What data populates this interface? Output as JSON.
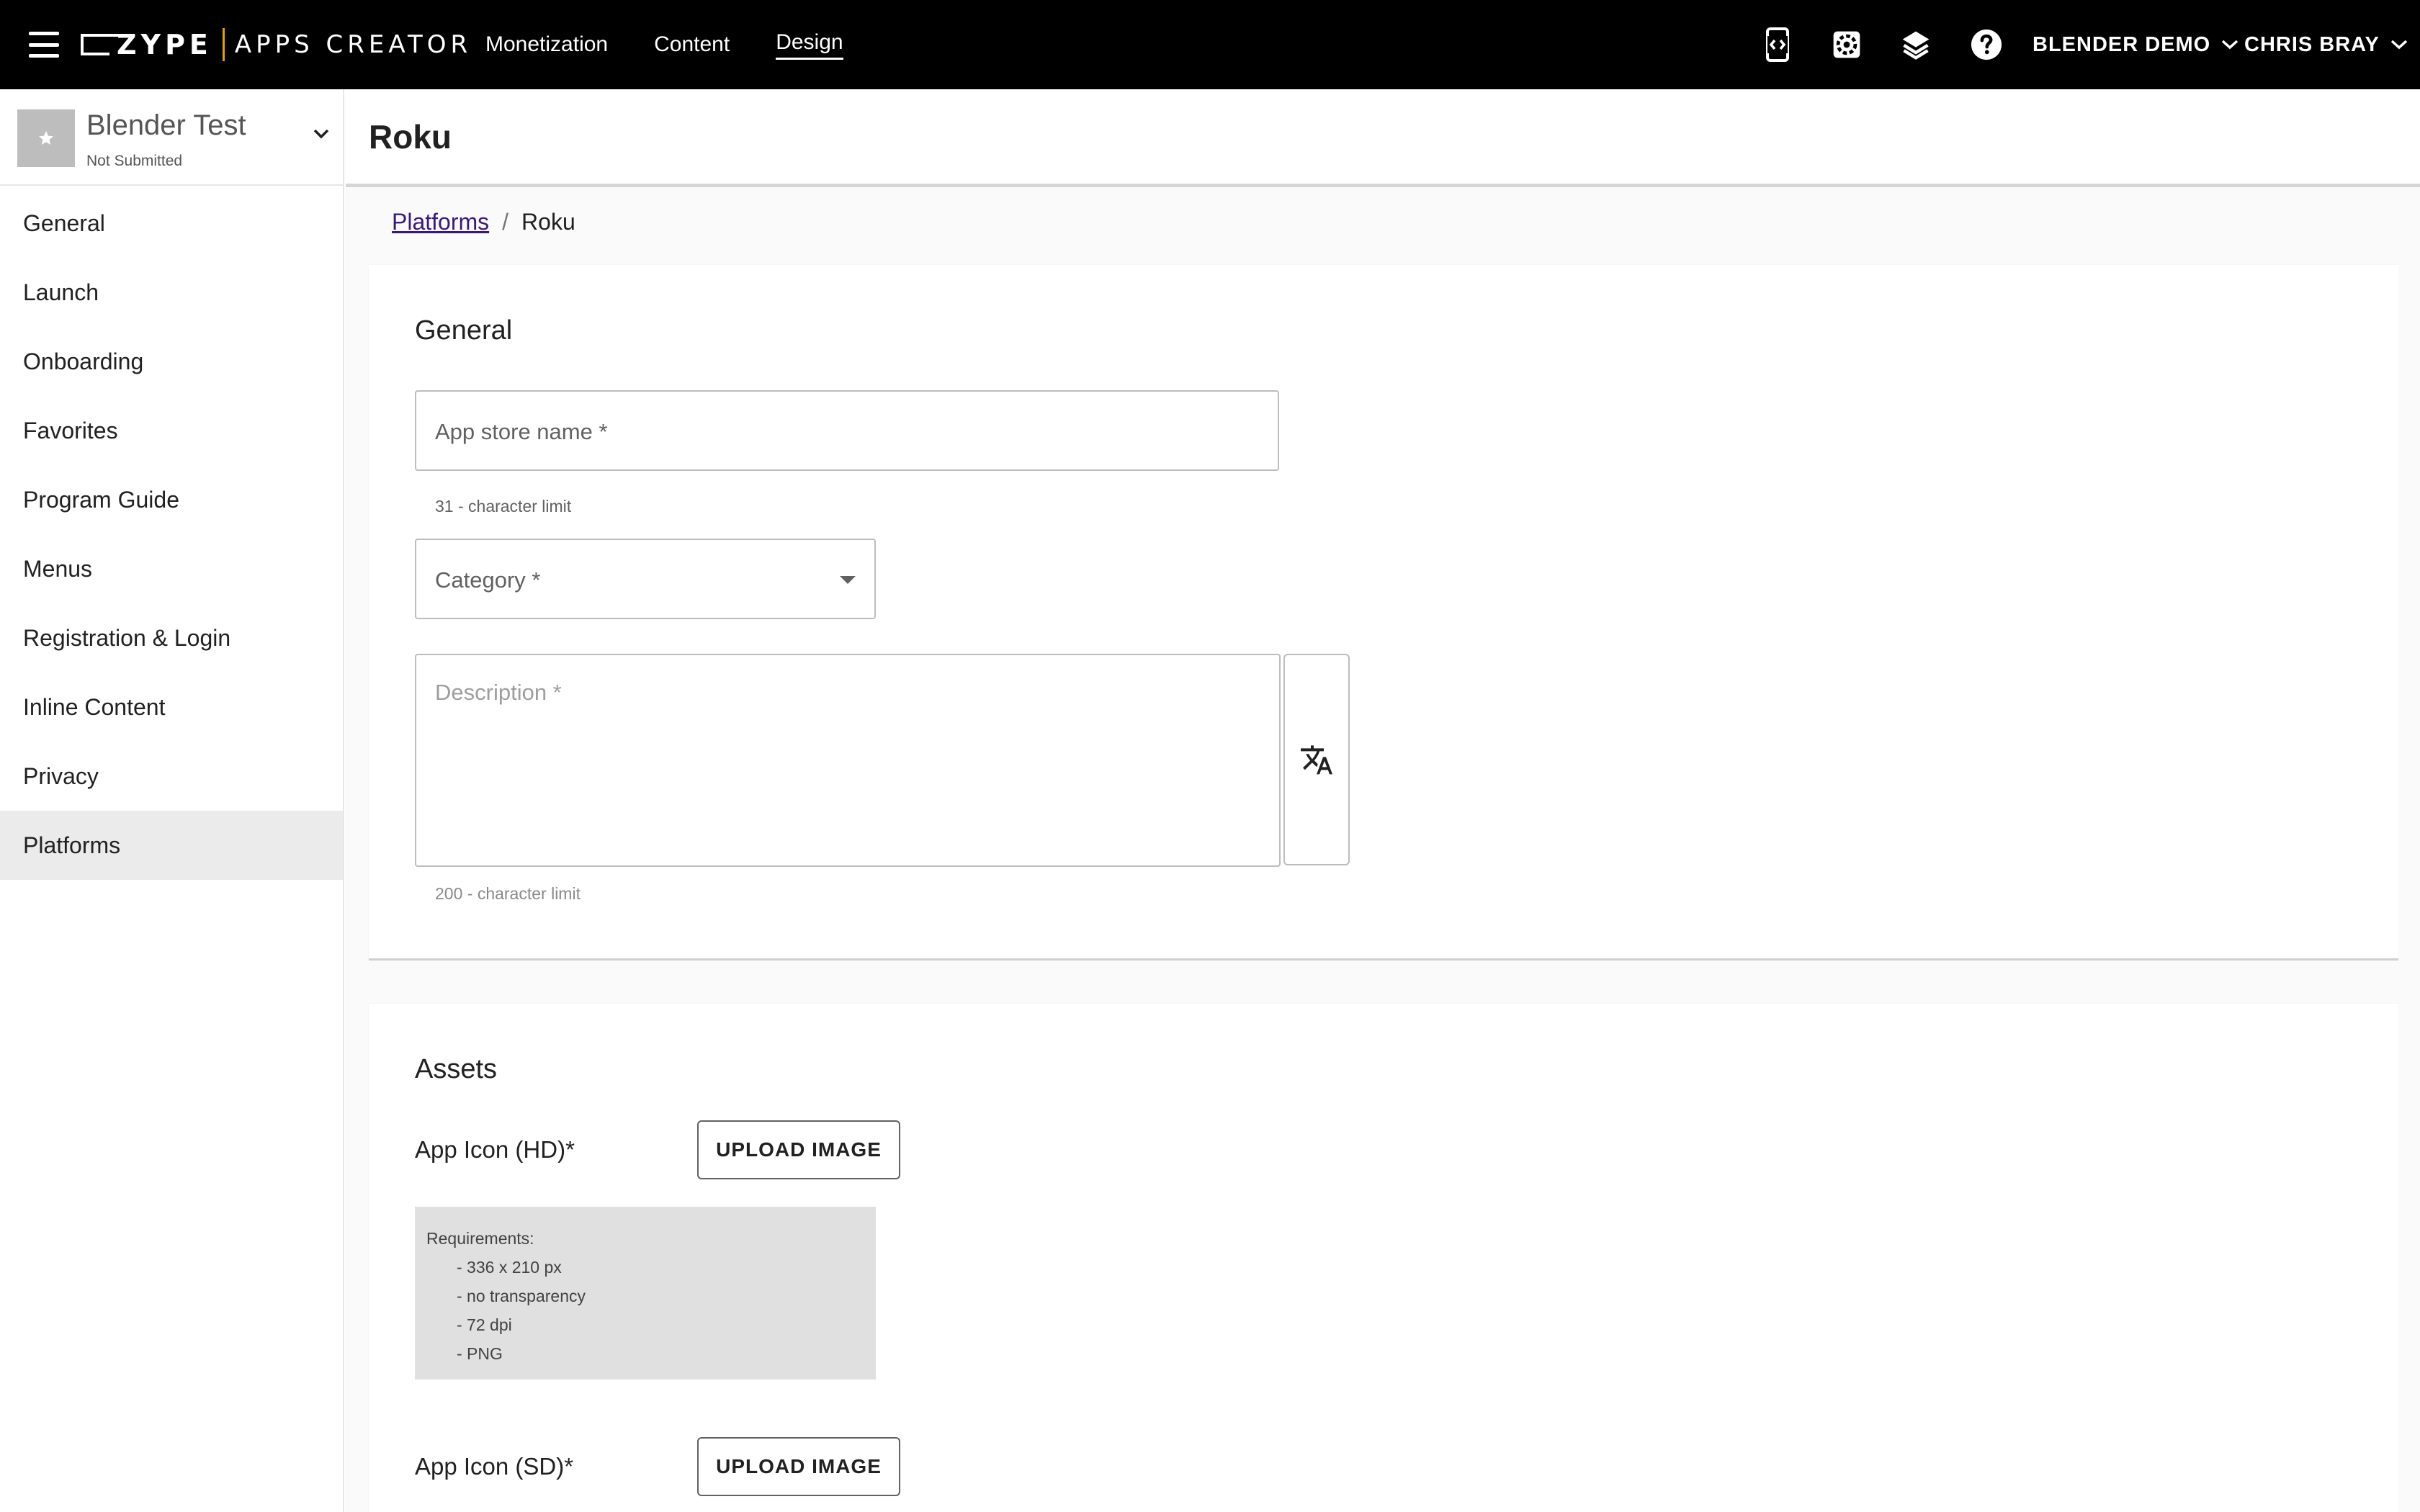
{
  "topbar": {
    "brand_zype": "ZYPE",
    "brand_apps": "APPS CREATOR",
    "nav": [
      {
        "label": "Monetization",
        "active": false
      },
      {
        "label": "Content",
        "active": false
      },
      {
        "label": "Design",
        "active": true
      }
    ],
    "icons": [
      "code-device-icon",
      "settings-gear-icon",
      "layers-icon",
      "help-icon"
    ],
    "org_dropdown": "BLENDER DEMO",
    "user_dropdown": "CHRIS BRAY"
  },
  "sidebar": {
    "app_name": "Blender Test",
    "app_status": "Not Submitted",
    "items": [
      {
        "label": "General",
        "active": false
      },
      {
        "label": "Launch",
        "active": false
      },
      {
        "label": "Onboarding",
        "active": false
      },
      {
        "label": "Favorites",
        "active": false
      },
      {
        "label": "Program Guide",
        "active": false
      },
      {
        "label": "Menus",
        "active": false
      },
      {
        "label": "Registration & Login",
        "active": false
      },
      {
        "label": "Inline Content",
        "active": false
      },
      {
        "label": "Privacy",
        "active": false
      },
      {
        "label": "Platforms",
        "active": true
      }
    ]
  },
  "page": {
    "title": "Roku",
    "breadcrumb": {
      "parent": "Platforms",
      "separator": "/",
      "current": "Roku"
    }
  },
  "general": {
    "title": "General",
    "app_store_name": {
      "label": "App store name *",
      "value": "",
      "helper": "31 - character limit"
    },
    "category": {
      "label": "Category *",
      "value": ""
    },
    "description": {
      "label": "Description *",
      "value": "",
      "helper": "200 - character limit"
    }
  },
  "assets": {
    "title": "Assets",
    "hd_icon": {
      "label": "App Icon (HD)*",
      "button": "UPLOAD IMAGE",
      "requirements_title": "Requirements:",
      "requirements": [
        "- 336 x 210 px",
        "- no transparency",
        "- 72 dpi",
        "- PNG"
      ]
    },
    "sd_icon": {
      "label": "App Icon (SD)*",
      "button": "UPLOAD IMAGE"
    }
  }
}
